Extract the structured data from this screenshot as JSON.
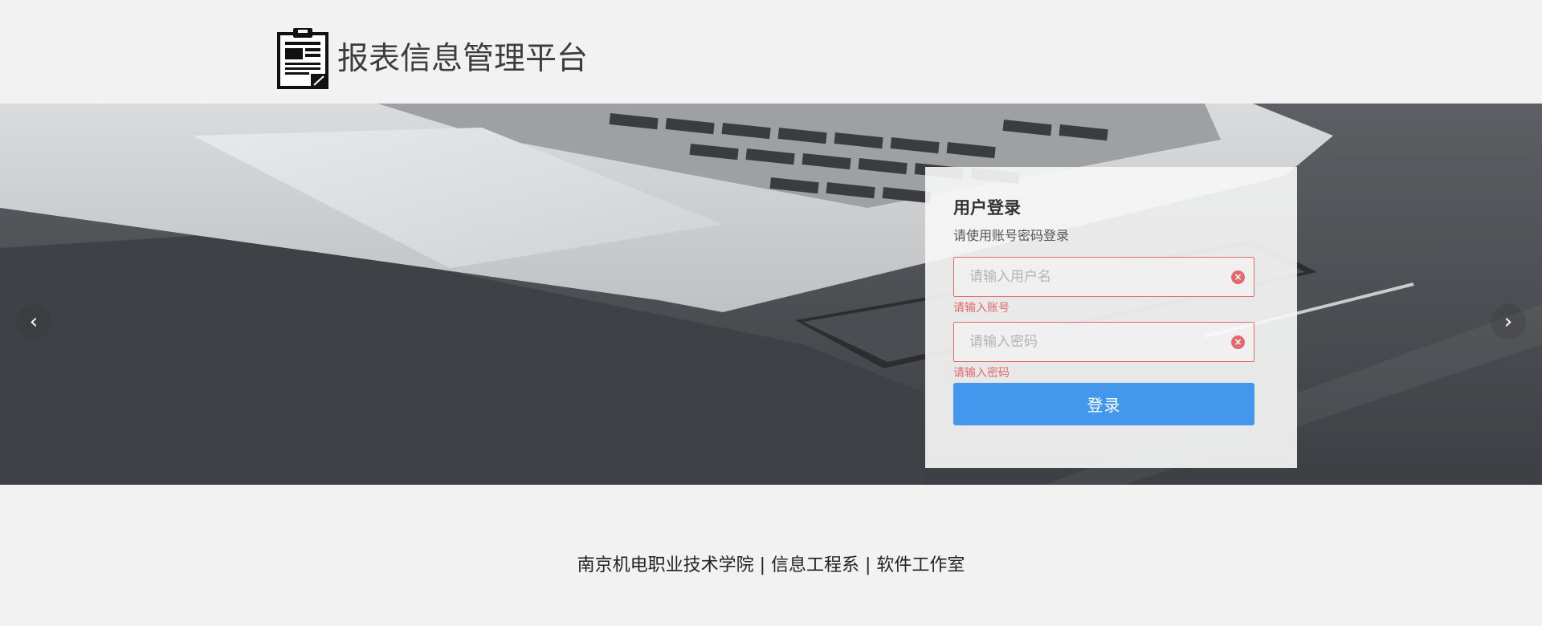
{
  "header": {
    "title": "报表信息管理平台",
    "logo_icon": "clipboard-report-icon"
  },
  "carousel": {
    "prev_icon": "chevron-left-icon",
    "next_icon": "chevron-right-icon",
    "prev_glyph": "‹",
    "next_glyph": "›"
  },
  "login": {
    "title": "用户登录",
    "subtitle": "请使用账号密码登录",
    "username": {
      "placeholder": "请输入用户名",
      "value": "",
      "error": "请输入账号"
    },
    "password": {
      "placeholder": "请输入密码",
      "value": "",
      "error": "请输入密码"
    },
    "clear_glyph": "×",
    "submit_label": "登录"
  },
  "footer": {
    "text": "南京机电职业技术学院 | 信息工程系 | 软件工作室"
  },
  "colors": {
    "accent": "#4398ee",
    "error": "#e3696d",
    "background": "#f2f2f2"
  }
}
